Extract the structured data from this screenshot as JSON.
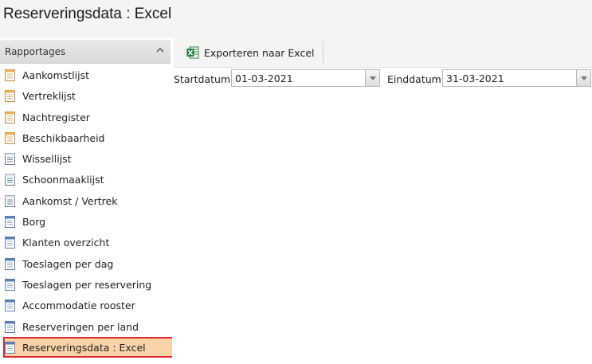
{
  "page": {
    "title": "Reserveringsdata : Excel"
  },
  "sidebar": {
    "header": "Rapportages",
    "items": [
      {
        "label": "Aankomstlijst",
        "icon": "report-orange-icon"
      },
      {
        "label": "Vertreklijst",
        "icon": "report-orange-icon"
      },
      {
        "label": "Nachtregister",
        "icon": "report-orange-icon"
      },
      {
        "label": "Beschikbaarheid",
        "icon": "report-orange-icon"
      },
      {
        "label": "Wissellijst",
        "icon": "report-list-icon"
      },
      {
        "label": "Schoonmaaklijst",
        "icon": "report-list-icon"
      },
      {
        "label": "Aankomst / Vertrek",
        "icon": "report-list-icon"
      },
      {
        "label": "Borg",
        "icon": "report-blue-icon"
      },
      {
        "label": "Klanten overzicht",
        "icon": "report-blue-icon"
      },
      {
        "label": "Toeslagen per dag",
        "icon": "report-blue-icon"
      },
      {
        "label": "Toeslagen per reservering",
        "icon": "report-blue-icon"
      },
      {
        "label": "Accommodatie rooster",
        "icon": "report-blue-icon"
      },
      {
        "label": "Reserveringen per land",
        "icon": "report-blue-icon"
      },
      {
        "label": "Reserveringsdata : Excel",
        "icon": "report-blue-icon",
        "active": true
      }
    ]
  },
  "toolbar": {
    "export_label": "Exporteren naar Excel"
  },
  "filters": {
    "start_label": "Startdatum",
    "start_value": "01-03-2021",
    "end_label": "Einddatum",
    "end_value": "31-03-2021"
  },
  "colors": {
    "active_bg": "#fbd3a8",
    "active_border": "#d9282f"
  }
}
